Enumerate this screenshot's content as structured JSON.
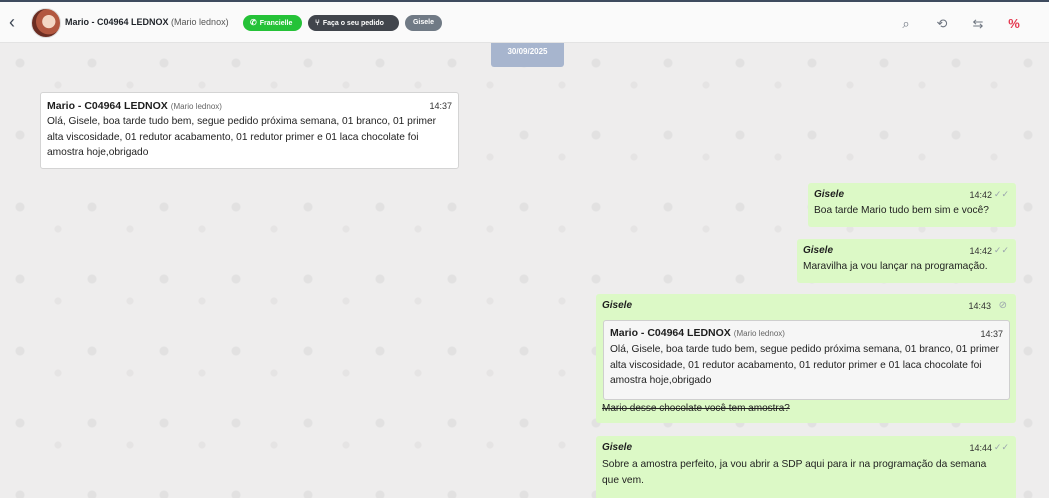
{
  "header": {
    "back_icon": "chevron-left-icon",
    "contact_name": "Mario - C04964 LEDNOX",
    "contact_subname": "(Mario lednox)",
    "tags": [
      {
        "label": "Francielle",
        "icon": "whatsapp-icon",
        "color": "#25c238"
      },
      {
        "label": "Faça o seu pedido",
        "icon": "flow-icon",
        "color": "#41454c"
      },
      {
        "label": "Gisele",
        "color": "#707a85"
      }
    ],
    "tools": [
      {
        "icon": "search-icon",
        "glyph": "⌕"
      },
      {
        "icon": "history-icon",
        "glyph": "⟲"
      },
      {
        "icon": "transfer-icon",
        "glyph": "⇆"
      },
      {
        "icon": "close-ticket-icon",
        "glyph": "%",
        "color": "#e53950"
      }
    ]
  },
  "chat": {
    "date": "30/09/2025",
    "messages": [
      {
        "direction": "in",
        "author": "Mario - C04964 LEDNOX",
        "author_sub": "(Mario lednox)",
        "time": "14:37",
        "text": "Olá, Gisele, boa tarde tudo bem, segue pedido próxima semana, 01 branco, 01 primer alta viscosidade, 01 redutor acabamento, 01 redutor primer e 01 laca chocolate foi amostra hoje,obrigado"
      },
      {
        "direction": "out",
        "author": "Gisele",
        "time": "14:42",
        "status": "read-ticks-icon",
        "text": "Boa tarde Mario tudo bem sim e você?"
      },
      {
        "direction": "out",
        "author": "Gisele",
        "time": "14:42",
        "status": "read-ticks-icon",
        "text": "Maravilha ja vou lançar na programação."
      },
      {
        "direction": "out",
        "author": "Gisele",
        "time": "14:43",
        "status": "deleted-icon",
        "quote": {
          "author": "Mario - C04964 LEDNOX",
          "author_sub": "(Mario lednox)",
          "time": "14:37",
          "text": "Olá, Gisele, boa tarde tudo bem, segue pedido próxima semana, 01 branco, 01 primer alta viscosidade, 01 redutor acabamento, 01 redutor primer e 01 laca chocolate foi amostra hoje,obrigado"
        },
        "text": "Mario desse chocolate você tem amostra?"
      },
      {
        "direction": "out",
        "author": "Gisele",
        "time": "14:44",
        "status": "read-ticks-icon",
        "text": "Sobre a amostra perfeito, ja vou abrir a SDP aqui para ir na programação da semana que vem."
      }
    ]
  },
  "colors": {
    "accent_green": "#25c238",
    "outgoing_bubble": "#dcf9c6",
    "date_chip": "#a7b5ce",
    "alert": "#e53950"
  }
}
